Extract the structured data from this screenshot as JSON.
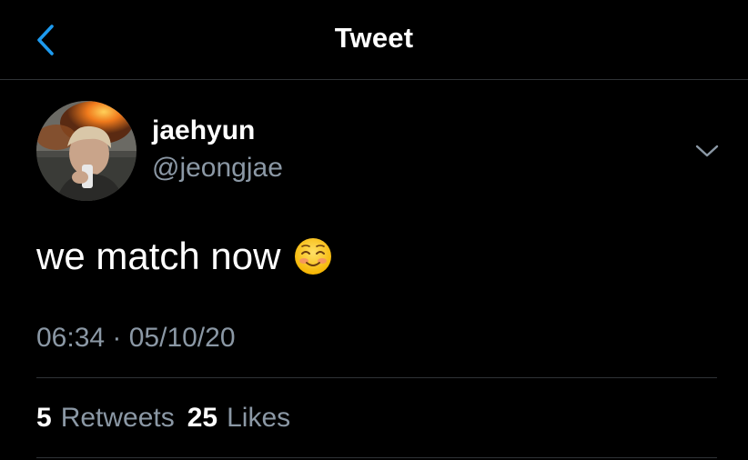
{
  "header": {
    "title": "Tweet",
    "back_icon": "chevron-left-icon"
  },
  "author": {
    "display_name": "jaehyun",
    "handle": "@jeongjae"
  },
  "tweet": {
    "text": "we match now",
    "emoji": "smiling-face-icon",
    "timestamp": "06:34 · 05/10/20"
  },
  "stats": {
    "retweets_count": "5",
    "retweets_label": "Retweets",
    "likes_count": "25",
    "likes_label": "Likes"
  },
  "colors": {
    "background": "#000000",
    "primary_text": "#ffffff",
    "secondary_text": "#8b98a5",
    "accent": "#1d9bf0",
    "divider": "#2f3336"
  }
}
